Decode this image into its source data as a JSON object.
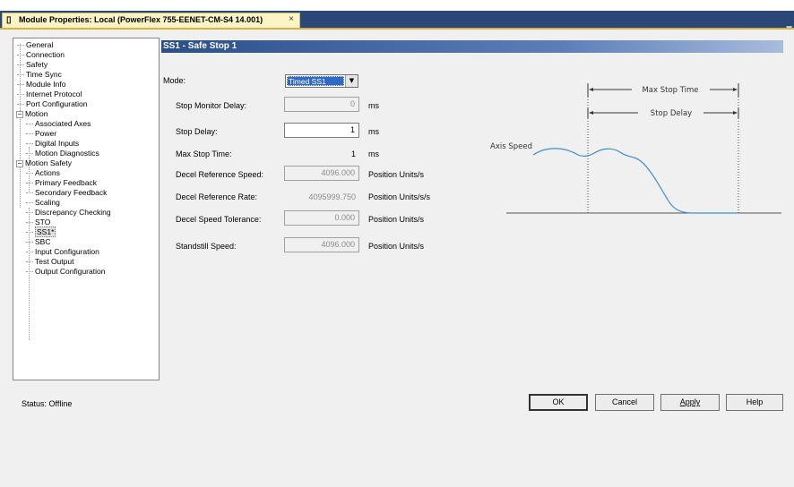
{
  "tab": {
    "title": "Module Properties: Local (PowerFlex 755-EENET-CM-S4 14.001)",
    "close": "×"
  },
  "window_marker": "▼",
  "tree": {
    "items": [
      "General",
      "Connection",
      "Safety",
      "Time Sync",
      "Module Info",
      "Internet Protocol",
      "Port Configuration",
      "Motion",
      "Associated Axes",
      "Power",
      "Digital Inputs",
      "Motion Diagnostics",
      "Motion Safety",
      "Actions",
      "Primary Feedback",
      "Secondary Feedback",
      "Scaling",
      "Discrepancy Checking",
      "STO",
      "SS1*",
      "SBC",
      "Input Configuration",
      "Test Output",
      "Output Configuration"
    ],
    "toggle_minus": "−"
  },
  "section_title": "SS1 - Safe Stop 1",
  "form": {
    "mode_label": "Mode:",
    "mode_value": "Timed SS1",
    "stop_monitor_delay": {
      "label": "Stop Monitor Delay:",
      "value": "0",
      "unit": "ms"
    },
    "stop_delay": {
      "label": "Stop Delay:",
      "value": "1",
      "unit": "ms"
    },
    "max_stop_time": {
      "label": "Max Stop Time:",
      "value": "1",
      "unit": "ms"
    },
    "decel_ref_speed": {
      "label": "Decel Reference Speed:",
      "value": "4096.000",
      "unit": "Position Units/s"
    },
    "decel_ref_rate": {
      "label": "Decel Reference Rate:",
      "value": "4095999.750",
      "unit": "Position Units/s/s"
    },
    "decel_speed_tol": {
      "label": "Decel Speed Tolerance:",
      "value": "0.000",
      "unit": "Position Units/s"
    },
    "standstill_speed": {
      "label": "Standstill Speed:",
      "value": "4096.000",
      "unit": "Position Units/s"
    }
  },
  "diagram": {
    "max_stop_time_label": "Max Stop Time",
    "stop_delay_label": "Stop Delay",
    "axis_speed_label": "Axis Speed",
    "curve_color": "#3a8fd0"
  },
  "status": "Status:  Offline",
  "buttons": {
    "ok": "OK",
    "cancel": "Cancel",
    "apply": "Apply",
    "help": "Help"
  },
  "colors": {
    "header_start": "#2b4f8a",
    "tab_bg": "#fdf4c5",
    "selection": "#3169c6"
  }
}
